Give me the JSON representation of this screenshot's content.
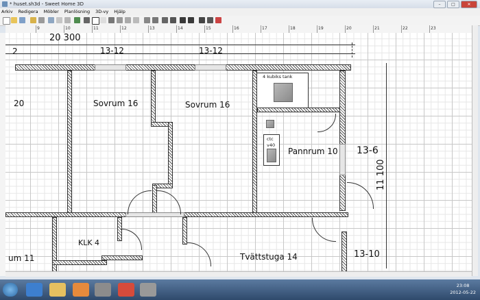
{
  "window": {
    "title": "* huset.sh3d - Sweet Home 3D"
  },
  "menu": [
    "Arkiv",
    "Redigera",
    "Möbler",
    "Planlösning",
    "3D-vy",
    "Hjälp"
  ],
  "ruler": {
    "top_ticks": [
      "9",
      "10",
      "11",
      "12",
      "13",
      "14",
      "15",
      "16",
      "17",
      "18",
      "19",
      "20",
      "21",
      "22",
      "23"
    ]
  },
  "plan": {
    "dims": {
      "top_total": "20 300",
      "left_partial": "2",
      "top_a": "13-12",
      "top_b": "13-12",
      "right_a": "13-6",
      "right_vertical": "11 100",
      "right_b": "13-10",
      "left_20": "20"
    },
    "rooms": {
      "sovrum_a": "Sovrum 16",
      "sovrum_b": "Sovrum 16",
      "pannrum": "Pannrum 10",
      "klk": "KLK 4",
      "tvattstuga": "Tvättstuga 14",
      "left_room": "um 11"
    },
    "furniture": {
      "tank": "4 kubiks tank",
      "ctc_a": "ctc",
      "ctc_b": "v40"
    }
  },
  "clock": {
    "time": "23:08",
    "date": "2012-05-22"
  },
  "colors": {
    "accent": "#2f4a6c",
    "wall": "#555555",
    "close": "#c9453a"
  }
}
